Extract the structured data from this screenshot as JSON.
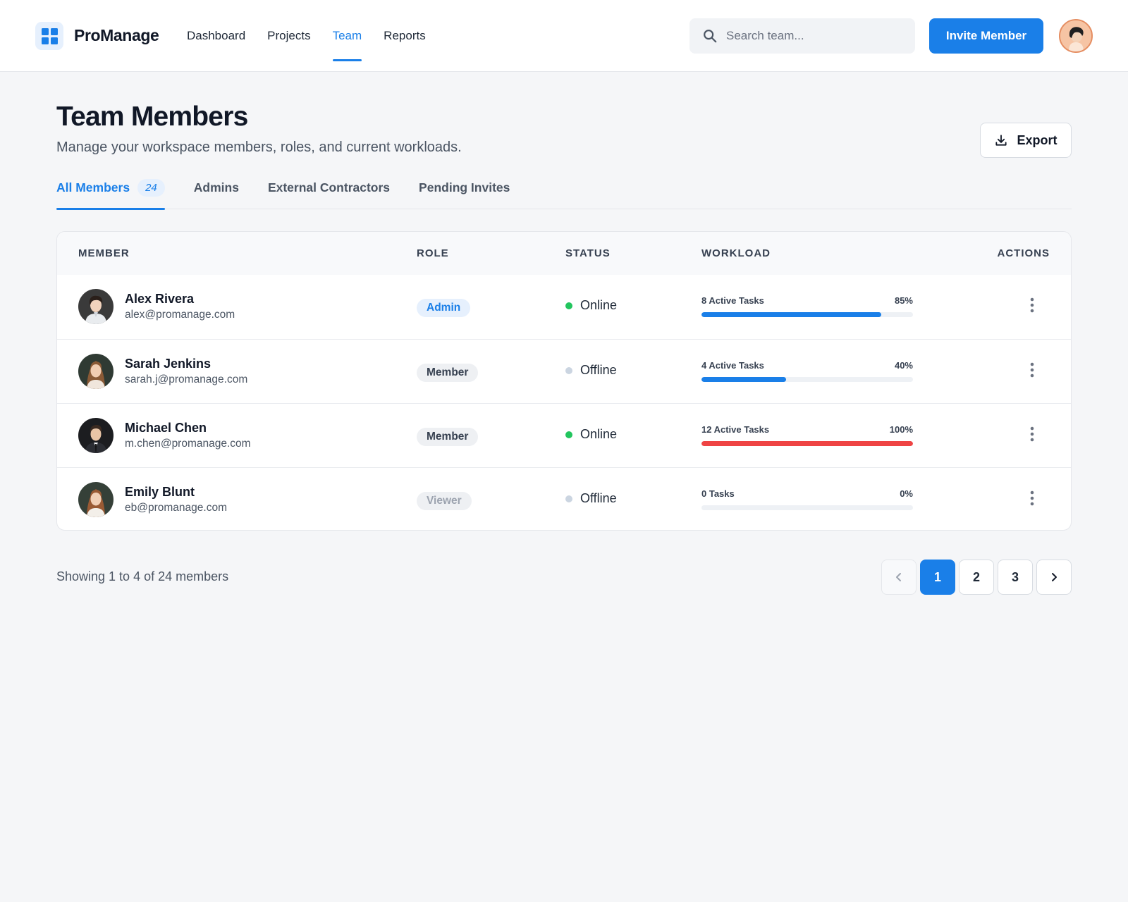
{
  "app": {
    "name": "ProManage"
  },
  "nav": {
    "items": [
      {
        "label": "Dashboard",
        "active": false
      },
      {
        "label": "Projects",
        "active": false
      },
      {
        "label": "Team",
        "active": true
      },
      {
        "label": "Reports",
        "active": false
      }
    ]
  },
  "search": {
    "placeholder": "Search team...",
    "value": "",
    "icon": "search-icon"
  },
  "header_actions": {
    "invite_label": "Invite Member"
  },
  "page": {
    "title": "Team Members",
    "subtitle": "Manage your workspace members, roles, and current workloads.",
    "export_label": "Export",
    "export_icon": "download-icon"
  },
  "tabs": [
    {
      "label": "All Members",
      "count": "24",
      "active": true
    },
    {
      "label": "Admins",
      "count": null,
      "active": false
    },
    {
      "label": "External Contractors",
      "count": null,
      "active": false
    },
    {
      "label": "Pending Invites",
      "count": null,
      "active": false
    }
  ],
  "table": {
    "columns": [
      "MEMBER",
      "ROLE",
      "STATUS",
      "WORKLOAD",
      "ACTIONS"
    ],
    "rows": [
      {
        "name": "Alex Rivera",
        "email": "alex@promanage.com",
        "role": "Admin",
        "role_style": "admin",
        "status": "Online",
        "workload_label": "8 Active Tasks",
        "workload_pct": "85%",
        "workload_value": 85,
        "workload_color": "#1a7fe8"
      },
      {
        "name": "Sarah Jenkins",
        "email": "sarah.j@promanage.com",
        "role": "Member",
        "role_style": "member",
        "status": "Offline",
        "workload_label": "4 Active Tasks",
        "workload_pct": "40%",
        "workload_value": 40,
        "workload_color": "#1a7fe8"
      },
      {
        "name": "Michael Chen",
        "email": "m.chen@promanage.com",
        "role": "Member",
        "role_style": "member",
        "status": "Online",
        "workload_label": "12 Active Tasks",
        "workload_pct": "100%",
        "workload_value": 100,
        "workload_color": "#ef4444"
      },
      {
        "name": "Emily Blunt",
        "email": "eb@promanage.com",
        "role": "Viewer",
        "role_style": "viewer",
        "status": "Offline",
        "workload_label": "0 Tasks",
        "workload_pct": "0%",
        "workload_value": 0,
        "workload_color": "#1a7fe8"
      }
    ]
  },
  "status_colors": {
    "Online": "#22c55e",
    "Offline": "#cbd5e1"
  },
  "footer": {
    "showing": "Showing 1 to 4 of 24 members",
    "pages": [
      "1",
      "2",
      "3"
    ],
    "current_page": "1"
  },
  "colors": {
    "accent": "#1a7fe8",
    "danger": "#ef4444",
    "background": "#f5f6f8"
  }
}
